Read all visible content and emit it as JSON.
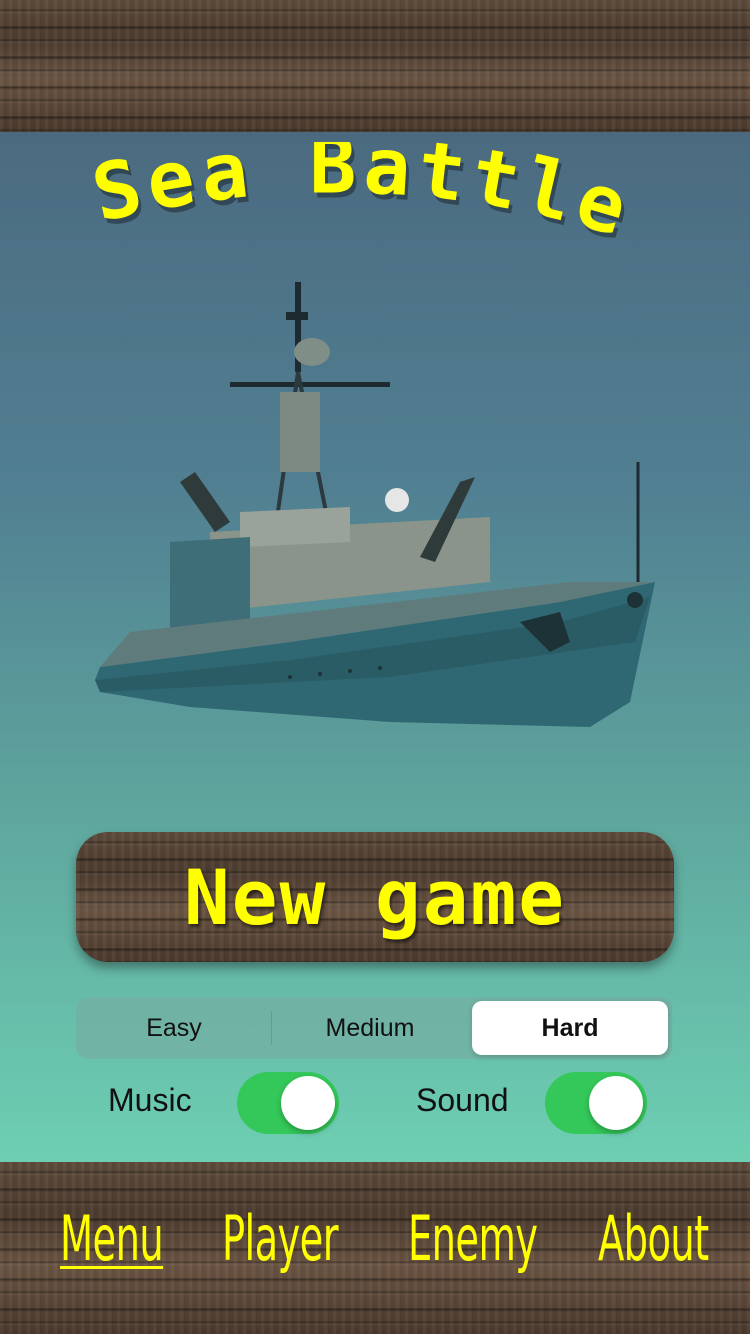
{
  "title": "Sea Battle",
  "new_game_label": "New game",
  "difficulty": {
    "options": [
      "Easy",
      "Medium",
      "Hard"
    ],
    "selected": "Hard"
  },
  "toggles": {
    "music": {
      "label": "Music",
      "on": true
    },
    "sound": {
      "label": "Sound",
      "on": true
    }
  },
  "tabs": [
    {
      "label": "Menu",
      "active": true
    },
    {
      "label": "Player",
      "active": false
    },
    {
      "label": "Enemy",
      "active": false
    },
    {
      "label": "About",
      "active": false
    }
  ],
  "colors": {
    "accent_yellow": "#ffff00",
    "switch_on": "#34c759"
  },
  "icons": {
    "hero_image": "warship-image"
  }
}
